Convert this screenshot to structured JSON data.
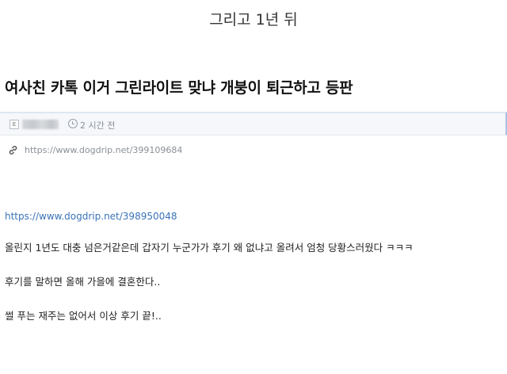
{
  "caption": "그리고 1년 뒤",
  "post": {
    "title": "여사친 카톡 이거 그린라이트 맞냐 개붕이 퇴근하고 등판",
    "meta": {
      "avatar_letter": "E",
      "time": "2 시간 전"
    },
    "source_url": "https://www.dogdrip.net/399109684",
    "body_link": "https://www.dogdrip.net/398950048",
    "body_lines": [
      "올린지 1년도 대충 넘은거같은데 갑자기 누군가가 후기 왜 없냐고 올려서 엄청 당황스러웠다 ㅋㅋㅋ",
      "후기를 말하면 올해 가을에 결혼한다..",
      "썰 푸는 재주는 없어서 이상 후기 끝!.."
    ]
  },
  "icons": {
    "time": "clock-icon",
    "source": "link-icon",
    "author": "avatar"
  },
  "colors": {
    "link": "#3a73b8",
    "meta_text": "#8a8f96",
    "accent_border": "#a9c4e6"
  }
}
